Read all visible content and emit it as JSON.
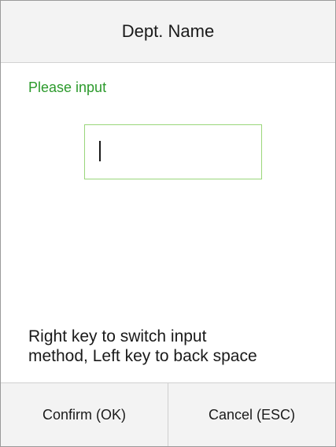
{
  "header": {
    "title": "Dept. Name"
  },
  "form": {
    "prompt": "Please input",
    "input_value": ""
  },
  "hint": {
    "line1": "Right key to switch input",
    "line2": "method, Left key to back space"
  },
  "footer": {
    "confirm_label": "Confirm (OK)",
    "cancel_label": "Cancel (ESC)"
  },
  "colors": {
    "prompt_text": "#2c9a2c",
    "input_border": "#9ad67a",
    "bar_background": "#f3f3f3"
  }
}
